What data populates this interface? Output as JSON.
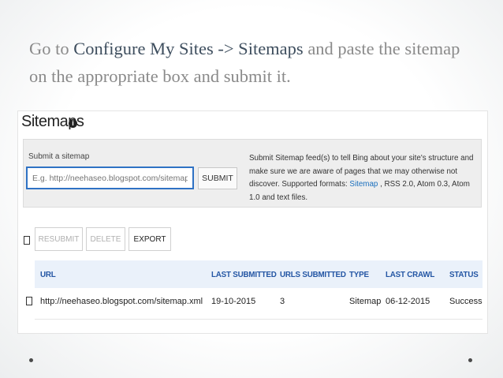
{
  "slide": {
    "title_prefix": "Go to ",
    "title_highlight": "Configure My Sites -> Sitemaps",
    "title_suffix": " and paste the sitemap on the appropriate box and submit it."
  },
  "sitemaps": {
    "heading": "Sitemaps",
    "info_glyph": "i",
    "submit_label": "Submit a sitemap",
    "input_placeholder": "E.g. http://neehaseo.blogspot.com/sitemap.xml",
    "submit_button": "SUBMIT",
    "help_text_1": "Submit Sitemap feed(s) to tell Bing about your site's structure and make sure we are aware of pages that we may otherwise not discover. Supported formats: ",
    "help_link": "Sitemap",
    "help_text_2": " , RSS 2.0, Atom 0.3, Atom 1.0 and text files.",
    "actions": {
      "resubmit": "RESUBMIT",
      "delete": "DELETE",
      "export": "EXPORT"
    },
    "columns": {
      "url": "URL",
      "last_submitted": "LAST SUBMITTED",
      "urls_submitted": "URLS SUBMITTED",
      "type": "TYPE",
      "last_crawl": "LAST CRAWL",
      "status": "STATUS"
    },
    "rows": [
      {
        "url": "http://neehaseo.blogspot.com/sitemap.xml",
        "last_submitted": "19-10-2015",
        "urls_submitted": "3",
        "type": "Sitemap",
        "last_crawl": "06-12-2015",
        "status": "Success"
      }
    ]
  },
  "colors": {
    "title_text": "#8a8a8a",
    "title_highlight": "#3e4e5e",
    "header_text": "#2456a4",
    "input_border": "#2f72c4",
    "table_header_bg": "#eaf1fa"
  },
  "footer": {
    "bullet_icons": [
      "dot-icon",
      "dot-icon"
    ]
  }
}
